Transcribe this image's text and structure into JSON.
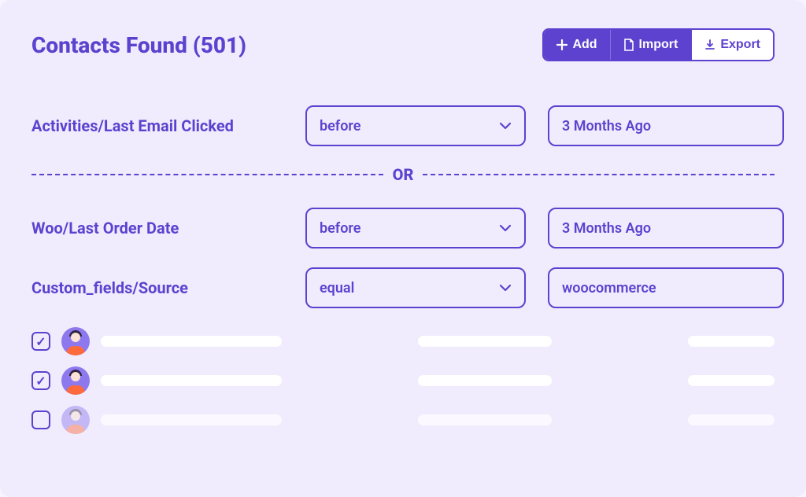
{
  "header": {
    "title": "Contacts Found (501)",
    "buttons": {
      "add": "Add",
      "import": "Import",
      "export": "Export"
    }
  },
  "filters": [
    {
      "label": "Activities/Last Email Clicked",
      "operator": "before",
      "value": "3 Months Ago"
    },
    {
      "label": "Woo/Last Order Date",
      "operator": "before",
      "value": "3 Months Ago"
    },
    {
      "label": "Custom_fields/Source",
      "operator": "equal",
      "value": "woocommerce"
    }
  ],
  "divider_label": "OR",
  "results": [
    {
      "checked": true,
      "faded": false
    },
    {
      "checked": true,
      "faded": false
    },
    {
      "checked": false,
      "faded": true
    }
  ],
  "colors": {
    "accent": "#5d42cf",
    "panel_bg": "#f0ecfd"
  }
}
